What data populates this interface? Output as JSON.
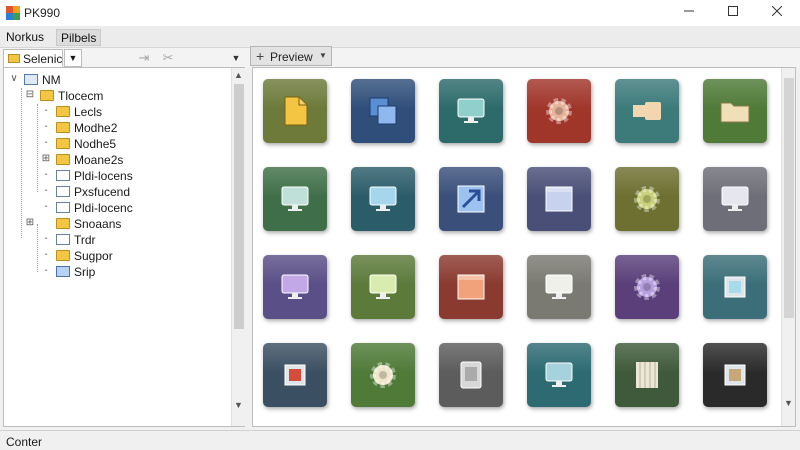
{
  "window": {
    "title": "PK990"
  },
  "menu": {
    "items": [
      {
        "label": "Norkus"
      },
      {
        "label": "Pilbels"
      }
    ]
  },
  "toolbar": {
    "tab_label": "Selenic",
    "preview_label": "Preview"
  },
  "tree": {
    "items": [
      {
        "label": "NM",
        "icon": "drive-icon"
      },
      {
        "label": "Tlocecm",
        "icon": "folder-icon"
      },
      {
        "label": "Lecls",
        "icon": "folder-icon"
      },
      {
        "label": "Modhe2",
        "icon": "folder-icon"
      },
      {
        "label": "Nodhe5",
        "icon": "folder-icon"
      },
      {
        "label": "Moane2s",
        "icon": "folder-icon"
      },
      {
        "label": "Pldi-locens",
        "icon": "document-icon"
      },
      {
        "label": "Pxsfucend",
        "icon": "document-icon"
      },
      {
        "label": "Pldi-locenc",
        "icon": "document-icon"
      },
      {
        "label": "Snoaans",
        "icon": "folder-icon"
      },
      {
        "label": "Trdr",
        "icon": "document-icon"
      },
      {
        "label": "Sugpor",
        "icon": "folder-icon"
      },
      {
        "label": "Srip",
        "icon": "folder-icon"
      }
    ]
  },
  "tiles": [
    {
      "icon": "document-icon",
      "color": "#6d7a3a",
      "accent": "#f4c542"
    },
    {
      "icon": "copy-icon",
      "color": "#2f4f7a",
      "accent": "#5a8fd4"
    },
    {
      "icon": "monitor-icon",
      "color": "#2d6a6a",
      "accent": "#8fd0cc"
    },
    {
      "icon": "gear-icon",
      "color": "#a0352a",
      "accent": "#e6b39a"
    },
    {
      "icon": "connector-icon",
      "color": "#3d7a7a",
      "accent": "#f2d6b0"
    },
    {
      "icon": "folder-icon",
      "color": "#4f7a38",
      "accent": "#efe0b8"
    },
    {
      "icon": "monitor-icon",
      "color": "#3f6f48",
      "accent": "#bfe0d8"
    },
    {
      "icon": "monitor-icon",
      "color": "#2b5c6a",
      "accent": "#a6d6ec"
    },
    {
      "icon": "arrow-window-icon",
      "color": "#3a4f7a",
      "accent": "#9ec2ef"
    },
    {
      "icon": "window-icon",
      "color": "#4a4f78",
      "accent": "#c7d2ee"
    },
    {
      "icon": "gear-icon",
      "color": "#6d7030",
      "accent": "#c8d078"
    },
    {
      "icon": "monitor-icon",
      "color": "#6e6e78",
      "accent": "#e6e6ee"
    },
    {
      "icon": "monitor-icon",
      "color": "#5a4f86",
      "accent": "#c2a8e6"
    },
    {
      "icon": "monitor-icon",
      "color": "#5c7a3a",
      "accent": "#d8ecb0"
    },
    {
      "icon": "window-icon",
      "color": "#8a3a2f",
      "accent": "#f2a27a"
    },
    {
      "icon": "monitor-icon",
      "color": "#7a7a72",
      "accent": "#f0f0ea"
    },
    {
      "icon": "gear-icon",
      "color": "#5a3f7a",
      "accent": "#b8a0e0"
    },
    {
      "icon": "chip-icon",
      "color": "#3b6e78",
      "accent": "#a8dcea"
    },
    {
      "icon": "chip-icon",
      "color": "#3b4f62",
      "accent": "#d84a3a"
    },
    {
      "icon": "gear-icon",
      "color": "#4f7a38",
      "accent": "#efe6cc"
    },
    {
      "icon": "device-icon",
      "color": "#5c5c5c",
      "accent": "#d8d8d8"
    },
    {
      "icon": "monitor-icon",
      "color": "#2d6a72",
      "accent": "#a6d2de"
    },
    {
      "icon": "server-icon",
      "color": "#3f5a3a",
      "accent": "#ebe6d6"
    },
    {
      "icon": "chip-icon",
      "color": "#2a2a2a",
      "accent": "#c8a878"
    }
  ],
  "status": {
    "text": "Conter"
  }
}
